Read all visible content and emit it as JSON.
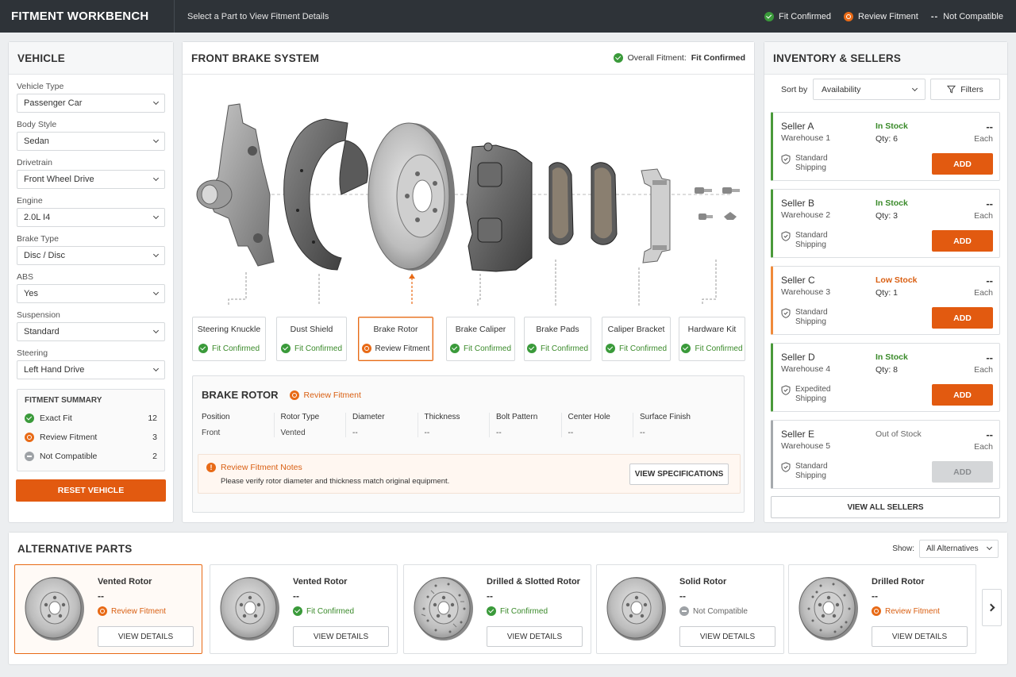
{
  "app": {
    "title": "FITMENT WORKBENCH",
    "prompt": "Select a Part to View Fitment Details"
  },
  "legend": {
    "confirmed": "Fit Confirmed",
    "review": "Review Fitment",
    "not_mark": "--",
    "not_compatible": "Not Compatible"
  },
  "vehicle": {
    "title": "VEHICLE",
    "fields": [
      {
        "label": "Vehicle Type",
        "value": "Passenger Car"
      },
      {
        "label": "Body Style",
        "value": "Sedan"
      },
      {
        "label": "Drivetrain",
        "value": "Front Wheel Drive"
      },
      {
        "label": "Engine",
        "value": "2.0L I4"
      },
      {
        "label": "Brake Type",
        "value": "Disc / Disc"
      },
      {
        "label": "ABS",
        "value": "Yes"
      },
      {
        "label": "Suspension",
        "value": "Standard"
      },
      {
        "label": "Steering",
        "value": "Left Hand Drive"
      }
    ],
    "summary": {
      "title": "FITMENT SUMMARY",
      "rows": [
        {
          "label": "Exact Fit",
          "count": "12"
        },
        {
          "label": "Review Fitment",
          "count": "3"
        },
        {
          "label": "Not Compatible",
          "count": "2"
        }
      ]
    },
    "reset_label": "RESET VEHICLE"
  },
  "brake": {
    "title": "FRONT BRAKE SYSTEM",
    "overall_label": "Overall Fitment:",
    "overall_value": "Fit Confirmed",
    "parts": [
      {
        "name": "Steering Knuckle",
        "status": "Fit Confirmed"
      },
      {
        "name": "Dust Shield",
        "status": "Fit Confirmed"
      },
      {
        "name": "Brake Rotor",
        "status": "Review Fitment"
      },
      {
        "name": "Brake Caliper",
        "status": "Fit Confirmed"
      },
      {
        "name": "Brake Pads",
        "status": "Fit Confirmed"
      },
      {
        "name": "Caliper Bracket",
        "status": "Fit Confirmed"
      },
      {
        "name": "Hardware Kit",
        "status": "Fit Confirmed"
      }
    ],
    "detail": {
      "title": "BRAKE ROTOR",
      "status": "Review Fitment",
      "specs": [
        {
          "label": "Position",
          "value": "Front"
        },
        {
          "label": "Rotor Type",
          "value": "Vented"
        },
        {
          "label": "Diameter",
          "value": "--"
        },
        {
          "label": "Thickness",
          "value": "--"
        },
        {
          "label": "Bolt Pattern",
          "value": "--"
        },
        {
          "label": "Center Hole",
          "value": "--"
        },
        {
          "label": "Surface Finish",
          "value": "--"
        }
      ],
      "notes_title": "Review Fitment Notes",
      "notes_text": "Please verify rotor diameter and thickness match original equipment.",
      "notes_icon": "!",
      "view_spec_label": "VIEW SPECIFICATIONS"
    }
  },
  "inventory": {
    "title": "INVENTORY & SELLERS",
    "sort_label": "Sort by",
    "sort_value": "Availability",
    "filters_label": "Filters",
    "sellers": [
      {
        "name": "Seller A",
        "warehouse": "Warehouse 1",
        "stock": "In Stock",
        "qty": "Qty: 6",
        "price": "--",
        "unit": "Each",
        "ship1": "Standard",
        "ship2": "Shipping",
        "add": "ADD"
      },
      {
        "name": "Seller B",
        "warehouse": "Warehouse 2",
        "stock": "In Stock",
        "qty": "Qty: 3",
        "price": "--",
        "unit": "Each",
        "ship1": "Standard",
        "ship2": "Shipping",
        "add": "ADD"
      },
      {
        "name": "Seller C",
        "warehouse": "Warehouse 3",
        "stock": "Low Stock",
        "qty": "Qty: 1",
        "price": "--",
        "unit": "Each",
        "ship1": "Standard",
        "ship2": "Shipping",
        "add": "ADD"
      },
      {
        "name": "Seller D",
        "warehouse": "Warehouse 4",
        "stock": "In Stock",
        "qty": "Qty: 8",
        "price": "--",
        "unit": "Each",
        "ship1": "Expedited",
        "ship2": "Shipping",
        "add": "ADD"
      },
      {
        "name": "Seller E",
        "warehouse": "Warehouse 5",
        "stock": "Out of Stock",
        "qty": "",
        "price": "--",
        "unit": "Each",
        "ship1": "Standard",
        "ship2": "Shipping",
        "add": "ADD"
      }
    ],
    "view_all_label": "VIEW ALL SELLERS"
  },
  "alternatives": {
    "title": "ALTERNATIVE PARTS",
    "show_label": "Show:",
    "show_value": "All Alternatives",
    "items": [
      {
        "name": "Vented Rotor",
        "price": "--",
        "status": "Review Fitment",
        "button": "VIEW DETAILS"
      },
      {
        "name": "Vented Rotor",
        "price": "--",
        "status": "Fit Confirmed",
        "button": "VIEW DETAILS"
      },
      {
        "name": "Drilled & Slotted Rotor",
        "price": "--",
        "status": "Fit Confirmed",
        "button": "VIEW DETAILS"
      },
      {
        "name": "Solid Rotor",
        "price": "--",
        "status": "Not Compatible",
        "button": "VIEW DETAILS"
      },
      {
        "name": "Drilled Rotor",
        "price": "--",
        "status": "Review Fitment",
        "button": "VIEW DETAILS"
      }
    ]
  },
  "colors": {
    "accent": "#e25a10",
    "confirmed": "#3a9a3a",
    "review": "#e86a16",
    "not_compatible": "#9ea2a6",
    "topbar": "#2e3338"
  }
}
